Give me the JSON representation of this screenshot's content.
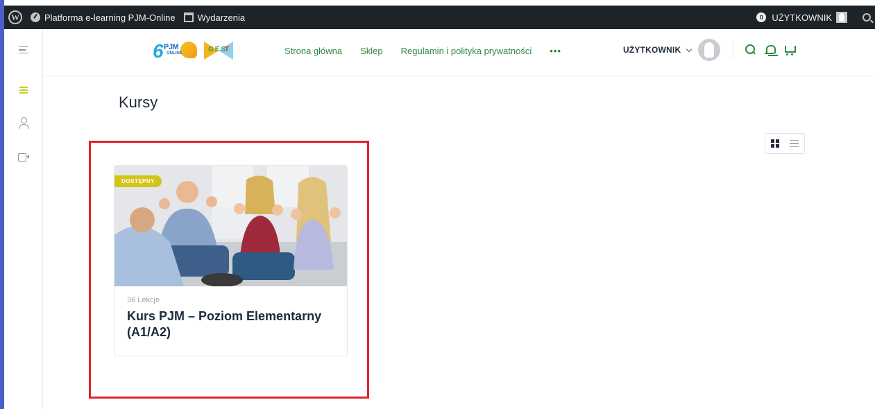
{
  "adminbar": {
    "site_name": "Platforma e-learning PJM-Online",
    "events": "Wydarzenia",
    "notifications_count": "0",
    "user_label": "UŻYTKOWNIK"
  },
  "header": {
    "logo_text": "PJM",
    "logo_sub": "ONLINE",
    "logo2_text": "GES",
    "logo2_t": "T",
    "nav": [
      {
        "label": "Strona główna"
      },
      {
        "label": "Sklep"
      },
      {
        "label": "Regulamin i polityka prywatności"
      },
      {
        "label": "•••"
      }
    ],
    "user_name": "UŻYTKOWNIK"
  },
  "main": {
    "title": "Kursy",
    "course": {
      "badge": "DOSTĘPNY",
      "lessons": "36 Lekcje",
      "title": "Kurs PJM – Poziom Elementarny (A1/A2)"
    }
  },
  "colors": {
    "accent_green": "#2e8b40",
    "badge_yellow": "#d4c41a",
    "highlight_red": "#e3202a",
    "adminbar_bg": "#1d2327"
  }
}
